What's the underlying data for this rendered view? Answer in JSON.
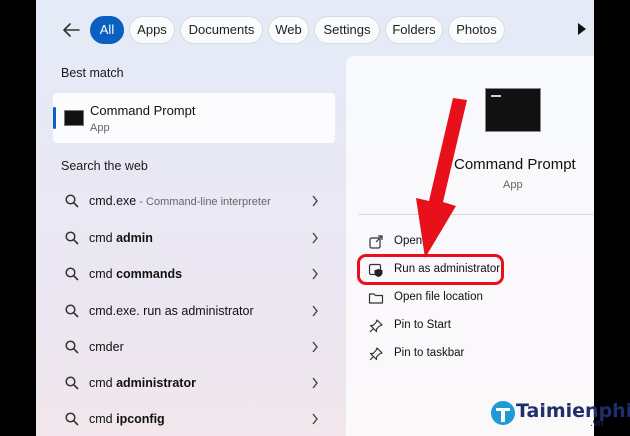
{
  "topbar": {
    "filters": [
      {
        "label": "All",
        "active": true
      },
      {
        "label": "Apps"
      },
      {
        "label": "Documents"
      },
      {
        "label": "Web"
      },
      {
        "label": "Settings"
      },
      {
        "label": "Folders"
      },
      {
        "label": "Photos"
      }
    ]
  },
  "left": {
    "best_match_header": "Best match",
    "best_match": {
      "title": "Command Prompt",
      "subtitle": "App"
    },
    "web_header": "Search the web",
    "web_results": [
      {
        "prefix": "cmd.exe",
        "bold": "",
        "desc": " - Command-line interpreter"
      },
      {
        "prefix": "cmd ",
        "bold": "admin",
        "desc": ""
      },
      {
        "prefix": "cmd ",
        "bold": "commands",
        "desc": ""
      },
      {
        "prefix": "cmd.exe. run as administrator",
        "bold": "",
        "desc": ""
      },
      {
        "prefix": "cmder",
        "bold": "",
        "desc": ""
      },
      {
        "prefix": "cmd ",
        "bold": "administrator",
        "desc": ""
      },
      {
        "prefix": "cmd ",
        "bold": "ipconfig",
        "desc": ""
      }
    ]
  },
  "right": {
    "title": "Command Prompt",
    "subtitle": "App",
    "actions": [
      {
        "label": "Open",
        "icon": "open-external-icon"
      },
      {
        "label": "Run as administrator",
        "icon": "shield-admin-icon"
      },
      {
        "label": "Open file location",
        "icon": "folder-icon"
      },
      {
        "label": "Pin to Start",
        "icon": "pin-icon"
      },
      {
        "label": "Pin to taskbar",
        "icon": "pin-icon"
      }
    ]
  },
  "watermark": {
    "brand": "Taimienphi",
    "tld": ".vn"
  },
  "colors": {
    "accent": "#0a5fc1",
    "annotation": "#e8101a",
    "brand": "#1f2f6e"
  }
}
